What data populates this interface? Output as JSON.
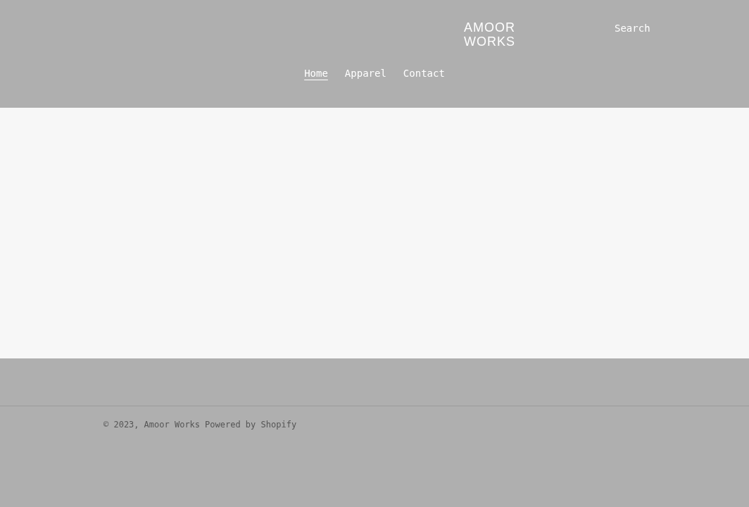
{
  "header": {
    "logo": "AMOOR WORKS",
    "search": "Search"
  },
  "nav": [
    {
      "label": "Home",
      "selected": true
    },
    {
      "label": "Apparel",
      "selected": false
    },
    {
      "label": "Contact",
      "selected": false
    }
  ],
  "footer": {
    "copyright": "© 2023,",
    "shop_link": "Amoor Works",
    "powered_by": "Powered by Shopify"
  }
}
